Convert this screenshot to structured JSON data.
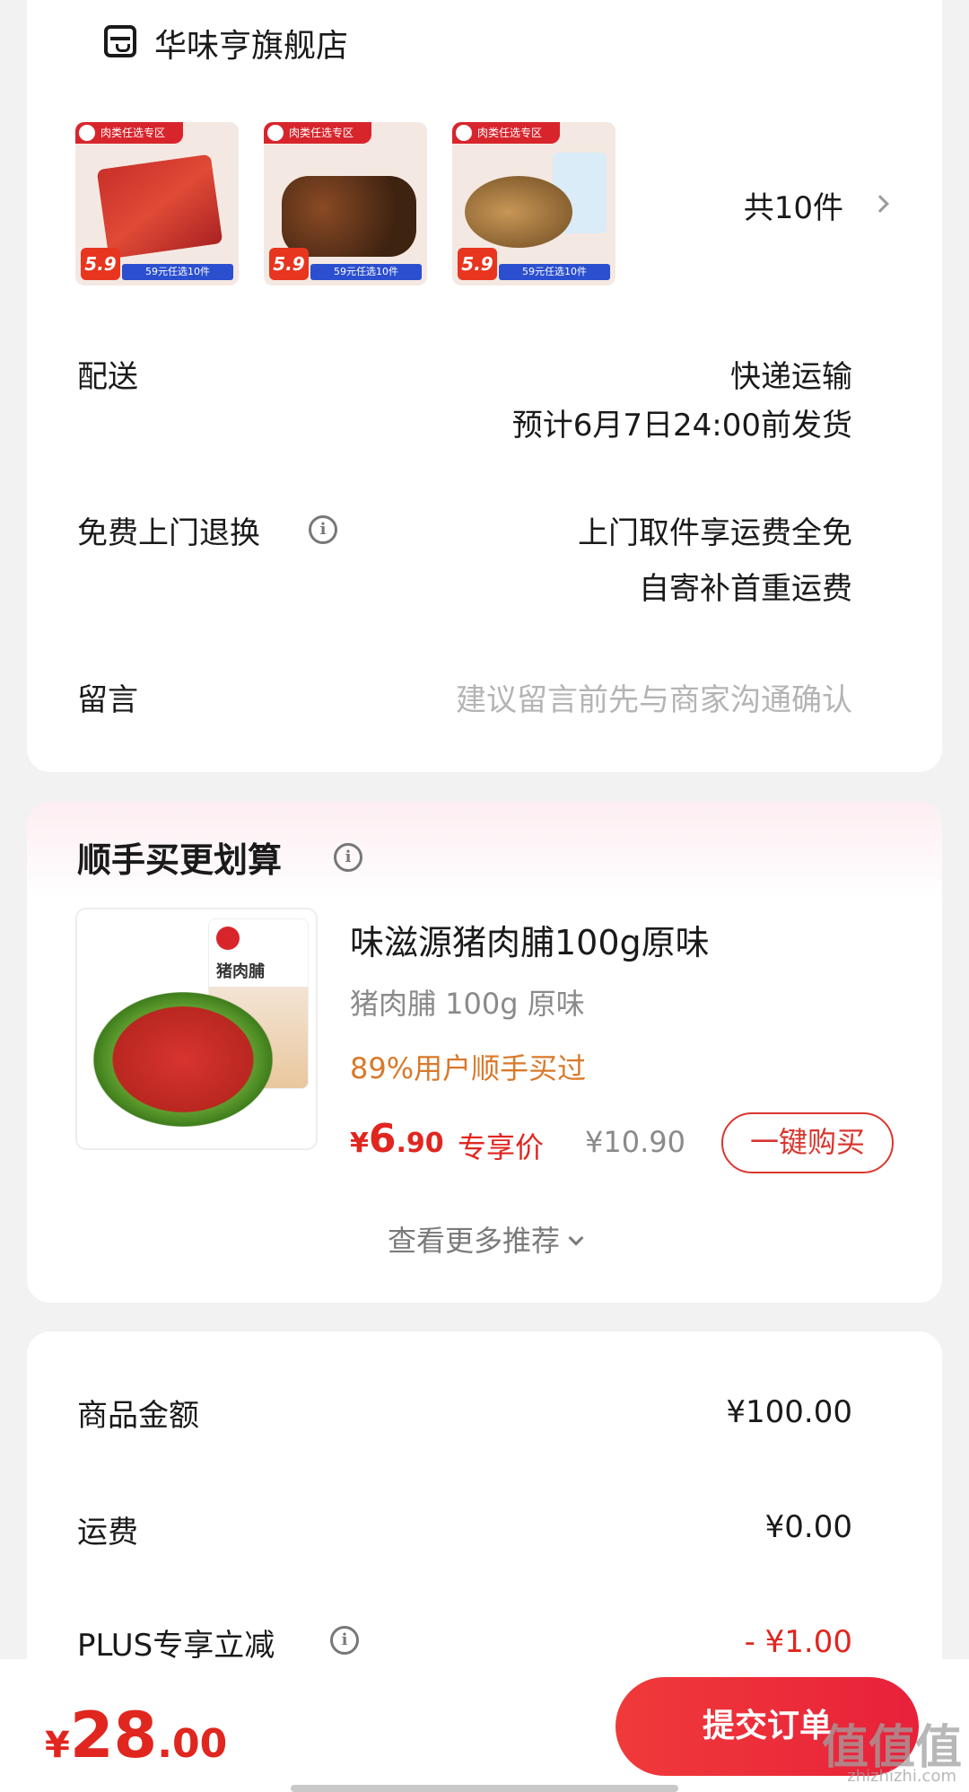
{
  "store": {
    "name": "华味亨旗舰店",
    "thumbnails": [
      {
        "tag": "肉类任选专区",
        "price": "5.9",
        "promo": "59元任选10件"
      },
      {
        "tag": "肉类任选专区",
        "price": "5.9",
        "promo": "59元任选10件"
      },
      {
        "tag": "肉类任选专区",
        "price": "5.9",
        "promo": "59元任选10件"
      }
    ],
    "count": "共10件"
  },
  "delivery": {
    "label": "配送",
    "method": "快递运输",
    "eta": "预计6月7日24:00前发货"
  },
  "returns": {
    "label": "免费上门退换",
    "line1": "上门取件享运费全免",
    "line2": "自寄补首重运费"
  },
  "note": {
    "label": "留言",
    "placeholder": "建议留言前先与商家沟通确认"
  },
  "bundle": {
    "title": "顺手买更划算",
    "product": {
      "image_bag_title": "猪肉脯",
      "title": "味滋源猪肉脯100g原味",
      "subtitle": "猪肉脯 100g 原味",
      "bought": "89%用户顺手买过",
      "price_currency": "¥",
      "price_int": "6",
      "price_dec": ".90",
      "exclusive": "专享价",
      "original_price": "¥10.90",
      "buy_label": "一键购买"
    },
    "more_label": "查看更多推荐"
  },
  "summary": {
    "goods_label": "商品金额",
    "goods_value": "¥100.00",
    "shipping_label": "运费",
    "shipping_value": "¥0.00",
    "plus_label": "PLUS专享立减",
    "plus_value": "- ¥1.00"
  },
  "bottom": {
    "total_currency": "¥",
    "total_int": "28",
    "total_dec": ".00",
    "submit_label": "提交订单"
  },
  "watermark": {
    "text": "值值值",
    "site": "zhizhizhi.com"
  },
  "colors": {
    "accent_red": "#e0261f",
    "orange": "#d9792a",
    "button_gradient_start": "#f03a3a",
    "button_gradient_end": "#e8213a"
  }
}
